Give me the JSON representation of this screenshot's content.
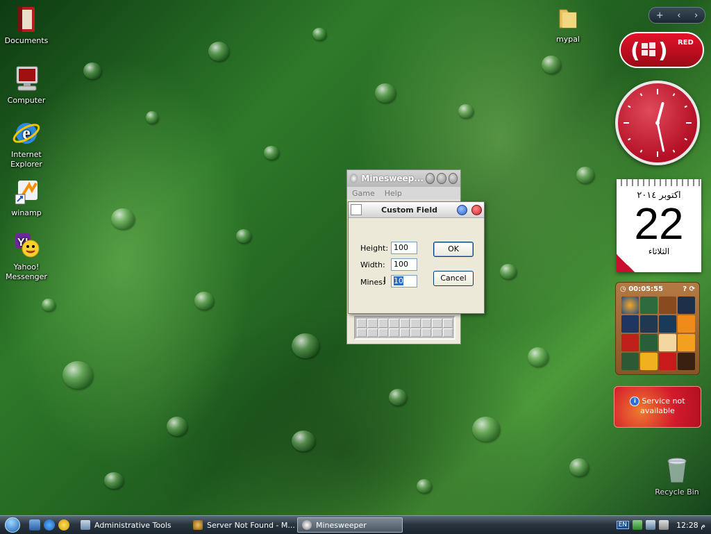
{
  "desktop": {
    "icons": [
      {
        "label": "Documents",
        "icon": "documents-folder-icon"
      },
      {
        "label": "Computer",
        "icon": "computer-icon"
      },
      {
        "label": "Internet Explorer",
        "icon": "internet-explorer-icon"
      },
      {
        "label": "winamp",
        "icon": "winamp-shortcut-icon"
      },
      {
        "label": "Yahoo! Messenger",
        "icon": "yahoo-messenger-icon"
      },
      {
        "label": "mypal",
        "icon": "folder-icon"
      },
      {
        "label": "Recycle Bin",
        "icon": "recycle-bin-icon"
      }
    ]
  },
  "gadgets": {
    "sidebar_control": {
      "add": "+",
      "prev": "‹",
      "next": "›"
    },
    "red_badge": {
      "brand": "RED"
    },
    "clock": {
      "hour_angle_deg": 15,
      "minute_angle_deg": 168
    },
    "calendar": {
      "month_year": "اکتوبر ۲۰۱٤",
      "day": "22",
      "weekday": "الثلاثاء"
    },
    "puzzle": {
      "timer": "00:05:55",
      "help": "?"
    },
    "weather": {
      "message_line1": "Service not",
      "message_line2": "available"
    }
  },
  "minesweeper_window": {
    "title": "Minesweep...",
    "menu": [
      "Game",
      "Help"
    ]
  },
  "custom_field_dialog": {
    "title": "Custom Field",
    "height_label": "Height:",
    "height_value": "100",
    "width_label": "Width:",
    "width_value": "100",
    "mines_label": "Mines:",
    "mines_value": "10",
    "ok_label": "OK",
    "cancel_label": "Cancel"
  },
  "taskbar": {
    "tasks": [
      {
        "label": "Administrative Tools",
        "icon": "control-panel-icon",
        "active": false
      },
      {
        "label": "Server Not Found - M...",
        "icon": "browser-icon",
        "active": false
      },
      {
        "label": "Minesweeper",
        "icon": "minesweeper-icon",
        "active": true
      }
    ],
    "tray": {
      "language": "EN",
      "time": "12:28 م"
    }
  },
  "colors": {
    "accent_red": "#d21a2c",
    "taskbar_dark": "#1c252e",
    "desktop_green": "#2e7a2a"
  }
}
